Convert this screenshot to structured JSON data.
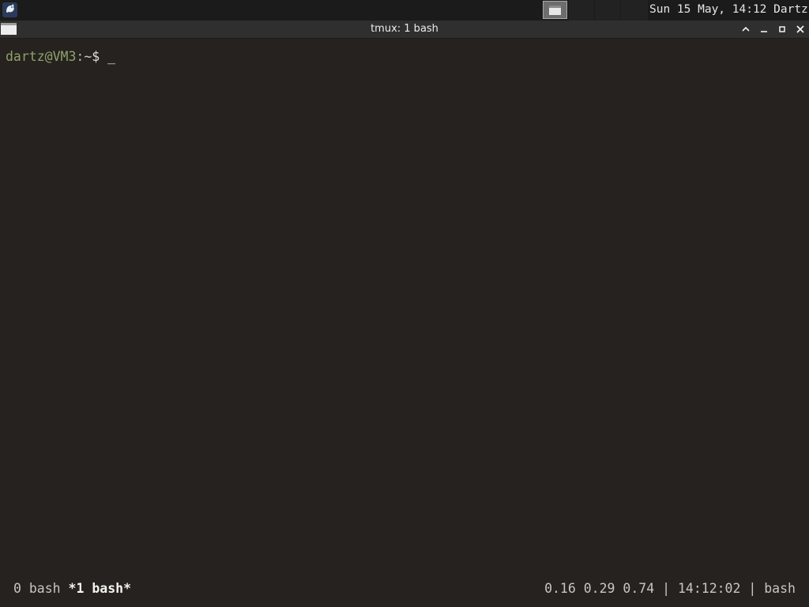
{
  "top_panel": {
    "app_menu_icon": "distro-logo-icon",
    "task_icon": "window-icon",
    "clock": "Sun 15 May, 14:12",
    "user": "Dartz"
  },
  "window": {
    "title": "tmux: 1 bash",
    "icon": "terminal-window-icon",
    "buttons": [
      "shade-up-icon",
      "minimize-icon",
      "maximize-icon",
      "close-icon"
    ]
  },
  "terminal": {
    "prompt": {
      "user_host": "dartz@VM3",
      "separator": ":",
      "path": "~",
      "symbol": "$",
      "cursor": "_"
    }
  },
  "tmux": {
    "windows": [
      {
        "label": "0 bash",
        "active": false
      },
      {
        "label": "*1 bash*",
        "active": true
      }
    ],
    "load": "0.16 0.29 0.74",
    "divider": "|",
    "time": "14:12:02",
    "current_command": "bash"
  },
  "colors": {
    "terminal_bg": "#26221f",
    "prompt_user": "#8fa26a",
    "panel_bg": "#1b1b1b",
    "titlebar_bg": "#2f2f2f"
  }
}
